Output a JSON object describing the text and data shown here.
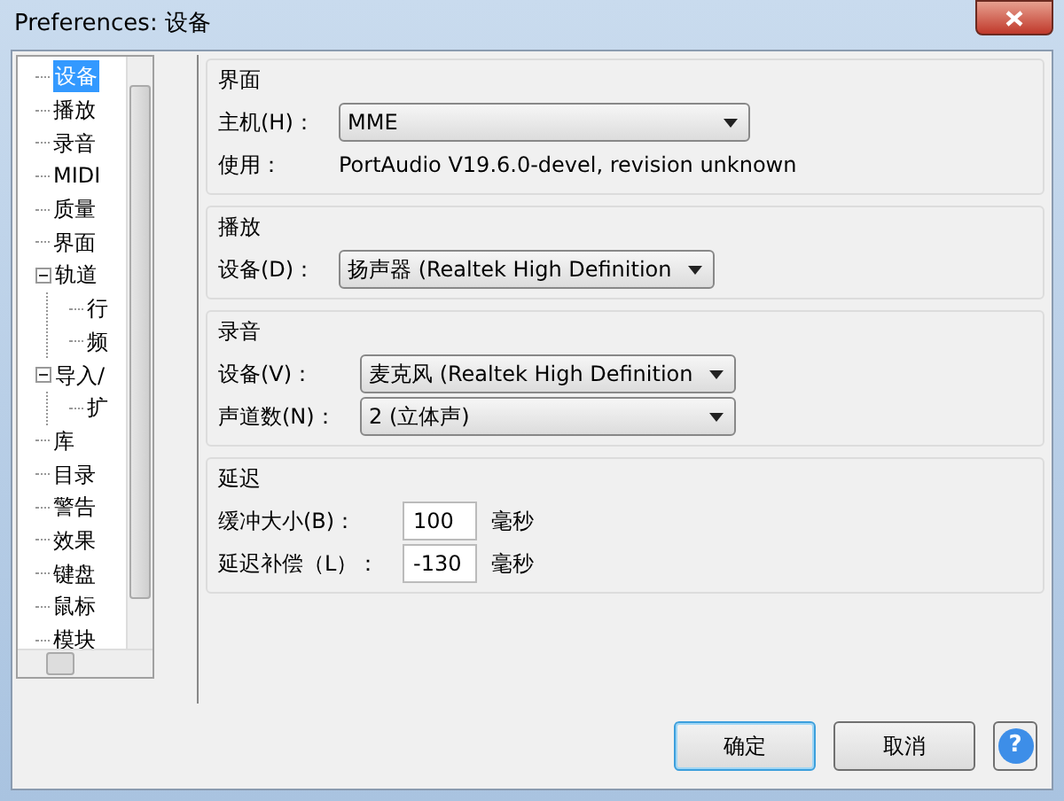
{
  "window": {
    "title": "Preferences: 设备"
  },
  "tree": [
    {
      "label": "设备",
      "selected": true
    },
    {
      "label": "播放",
      "selected": false
    },
    {
      "label": "录音",
      "selected": false
    },
    {
      "label": "MIDI",
      "selected": false
    },
    {
      "label": "质量",
      "selected": false
    },
    {
      "label": "界面",
      "selected": false
    },
    {
      "label": "轨道",
      "selected": false,
      "expanded": true,
      "children": [
        {
          "label": "行",
          "selected": false
        },
        {
          "label": "频",
          "selected": false
        }
      ]
    },
    {
      "label": "导入/",
      "selected": false,
      "expanded": true,
      "children": [
        {
          "label": "扩",
          "selected": false
        }
      ]
    },
    {
      "label": "库",
      "selected": false
    },
    {
      "label": "目录",
      "selected": false
    },
    {
      "label": "警告",
      "selected": false
    },
    {
      "label": "效果",
      "selected": false
    },
    {
      "label": "键盘",
      "selected": false
    },
    {
      "label": "鼠标",
      "selected": false
    },
    {
      "label": "模块",
      "selected": false
    }
  ],
  "sections": [
    {
      "title": "界面",
      "rows": [
        {
          "kind": "select",
          "label": "主机(H)：",
          "value": "MME"
        },
        {
          "kind": "text",
          "label": "使用：",
          "value": "PortAudio V19.6.0-devel, revision unknown"
        }
      ]
    },
    {
      "title": "播放",
      "rows": [
        {
          "kind": "select",
          "label": "设备(D)：",
          "value": "扬声器 (Realtek High Definition"
        }
      ]
    },
    {
      "title": "录音",
      "rows": [
        {
          "kind": "select",
          "label": "设备(V)：",
          "value": "麦克风 (Realtek High Definition"
        },
        {
          "kind": "select",
          "label": "声道数(N)：",
          "value": "2 (立体声)"
        }
      ]
    },
    {
      "title": "延迟",
      "rows": [
        {
          "kind": "input",
          "label": "缓冲大小(B)：",
          "value": "100",
          "unit": "毫秒"
        },
        {
          "kind": "input",
          "label": "延迟补偿（L）：",
          "value": "-130",
          "unit": "毫秒"
        }
      ]
    }
  ],
  "buttons": [
    {
      "label": "确定",
      "default": true
    },
    {
      "label": "取消",
      "default": false
    }
  ],
  "help": "?"
}
